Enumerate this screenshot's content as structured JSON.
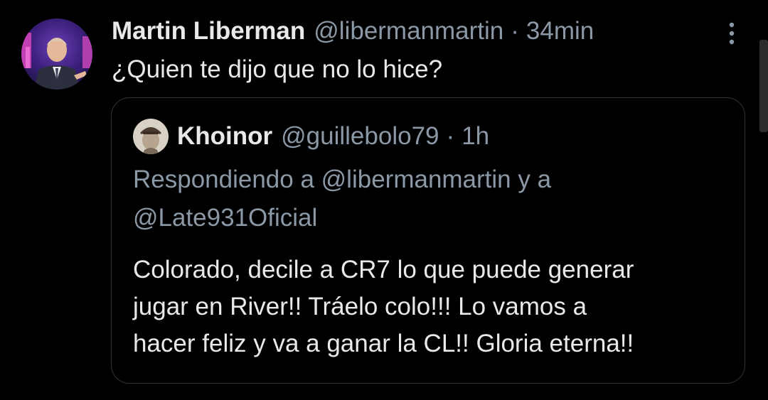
{
  "tweet": {
    "display_name": "Martin Liberman",
    "handle": "@libermanmartin",
    "separator": "·",
    "timestamp": "34min",
    "text": "¿Quien te dijo que no lo hice?",
    "more_icon": "more-vertical-icon"
  },
  "quoted_tweet": {
    "display_name": "Khoinor",
    "handle": "@guillebolo79",
    "separator": "·",
    "timestamp": "1h",
    "replying_lines": [
      "Respondiendo a @libermanmartin y a",
      "@Late931Oficial"
    ],
    "body_lines": [
      "Colorado, decile a CR7 lo que puede generar",
      "jugar en River!! Tráelo colo!!! Lo vamos a",
      "hacer feliz y va a ganar la CL!! Gloria eterna!!"
    ]
  },
  "colors": {
    "background": "#000000",
    "primary_text": "#e7e9ea",
    "secondary_text": "#8b98a5",
    "border": "#2f3336"
  }
}
